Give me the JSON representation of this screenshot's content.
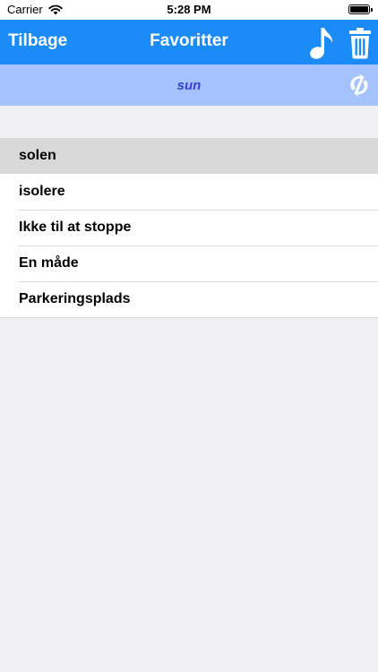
{
  "status_bar": {
    "carrier": "Carrier",
    "time": "5:28 PM"
  },
  "nav": {
    "back_label": "Tilbage",
    "title": "Favoritter",
    "icons": [
      "music-note-icon",
      "trash-icon"
    ]
  },
  "sub_bar": {
    "word": "sun",
    "icon": "swap-language-icon"
  },
  "favorites": [
    {
      "label": "solen",
      "selected": true
    },
    {
      "label": "isolere",
      "selected": false
    },
    {
      "label": "Ikke til at stoppe",
      "selected": false
    },
    {
      "label": "En måde",
      "selected": false
    },
    {
      "label": "Parkeringsplads",
      "selected": false
    }
  ],
  "colors": {
    "nav_bg": "#1b8cf7",
    "sub_bar_bg": "#a4c2fb",
    "sub_word": "#3b3fd6",
    "page_bg": "#efeff4",
    "selected_row": "#d8d8d8"
  }
}
